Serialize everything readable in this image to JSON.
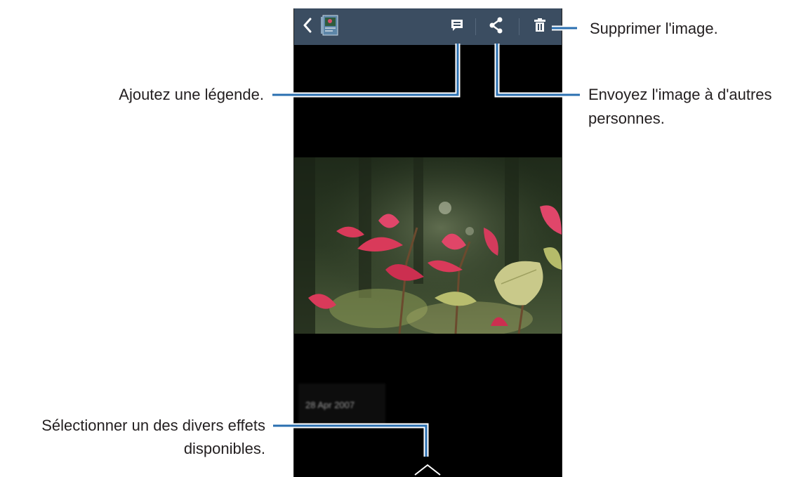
{
  "colors": {
    "actionbar": "#3b4d61",
    "screen_background": "#000000",
    "callout_line": "#2a6fb0",
    "callout_text": "#231f20"
  },
  "actionbar": {
    "icons": [
      "chevron-left-icon",
      "album-thumbnail-icon",
      "caption-icon",
      "share-icon",
      "trash-icon"
    ]
  },
  "photo": {
    "date": "28 Apr 2007"
  },
  "callouts": {
    "delete": "Supprimer l'image.",
    "caption": "Ajoutez une légende.",
    "share_line1": "Envoyez l'image à d'autres",
    "share_line2": "personnes.",
    "effects_line1": "Sélectionner un des divers effets",
    "effects_line2": "disponibles."
  }
}
